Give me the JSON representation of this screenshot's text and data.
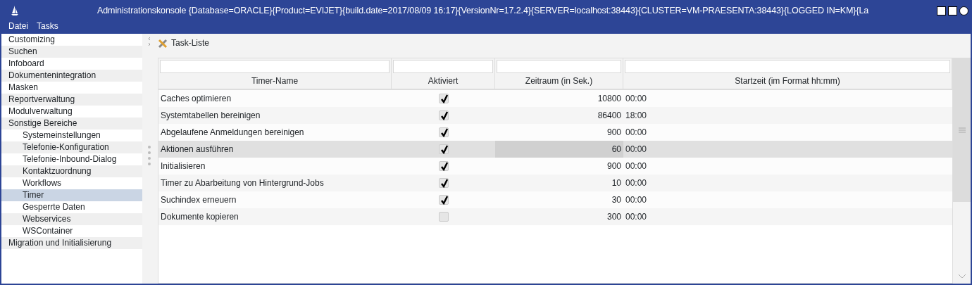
{
  "window": {
    "title": "Administrationskonsole {Database=ORACLE}{Product=EVIJET}{build.date=2017/08/09 16:17}{VersionNr=17.2.4}{SERVER=localhost:38443}{CLUSTER=VM-PRAESENTA:38443}{LOGGED IN=KM}{La"
  },
  "menu": [
    {
      "label": "Datei"
    },
    {
      "label": "Tasks"
    }
  ],
  "sidebar": {
    "items": [
      {
        "label": "Customizing",
        "selected": false
      },
      {
        "label": "Suchen",
        "selected": false
      },
      {
        "label": "Infoboard",
        "selected": false
      },
      {
        "label": "Dokumentenintegration",
        "selected": false
      },
      {
        "label": "Masken",
        "selected": false
      },
      {
        "label": "Reportverwaltung",
        "selected": false
      },
      {
        "label": "Modulverwaltung",
        "selected": false
      },
      {
        "label": "Sonstige Bereiche",
        "selected": false,
        "children": [
          {
            "label": "Systemeinstellungen",
            "selected": false
          },
          {
            "label": "Telefonie-Konfiguration",
            "selected": false
          },
          {
            "label": "Telefonie-Inbound-Dialog",
            "selected": false
          },
          {
            "label": "Kontaktzuordnung",
            "selected": false
          },
          {
            "label": "Workflows",
            "selected": false
          },
          {
            "label": "Timer",
            "selected": true
          },
          {
            "label": "Gesperrte Daten",
            "selected": false
          },
          {
            "label": "Webservices",
            "selected": false
          },
          {
            "label": "WSContainer",
            "selected": false
          }
        ]
      },
      {
        "label": "Migration und Initialisierung",
        "selected": false
      }
    ]
  },
  "panel": {
    "title": "Task-Liste"
  },
  "table": {
    "columns": [
      "Timer-Name",
      "Aktiviert",
      "Zeitraum (in Sek.)",
      "Startzeit (im Format hh:mm)"
    ],
    "rows": [
      {
        "name": "Caches optimieren",
        "active": true,
        "period": "10800",
        "start": "00:00",
        "selected": false
      },
      {
        "name": "Systemtabellen bereinigen",
        "active": true,
        "period": "86400",
        "start": "18:00",
        "selected": false
      },
      {
        "name": "Abgelaufene Anmeldungen bereinigen",
        "active": true,
        "period": "900",
        "start": "00:00",
        "selected": false
      },
      {
        "name": "Aktionen ausführen",
        "active": true,
        "period": "60",
        "start": "00:00",
        "selected": true
      },
      {
        "name": "Initialisieren",
        "active": true,
        "period": "900",
        "start": "00:00",
        "selected": false
      },
      {
        "name": "Timer zu Abarbeitung von Hintergrund-Jobs",
        "active": true,
        "period": "10",
        "start": "00:00",
        "selected": false
      },
      {
        "name": "Suchindex erneuern",
        "active": true,
        "period": "30",
        "start": "00:00",
        "selected": false
      },
      {
        "name": "Dokumente kopieren",
        "active": false,
        "period": "300",
        "start": "00:00",
        "selected": false
      }
    ]
  }
}
